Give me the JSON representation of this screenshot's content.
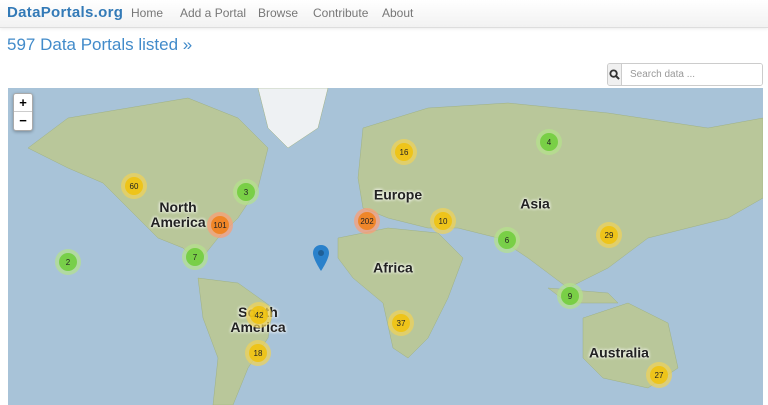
{
  "nav": {
    "brand": "DataPortals.org",
    "items": [
      "Home",
      "Add a Portal",
      "Browse",
      "Contribute",
      "About"
    ]
  },
  "title": "597 Data Portals listed »",
  "search": {
    "placeholder": "Search data ...",
    "icon": "search-icon"
  },
  "map": {
    "zoom_in": "+",
    "zoom_out": "−",
    "labels": {
      "north_america": "North\nAmerica",
      "south_america": "South\nAmerica",
      "europe": "Europe",
      "africa": "Africa",
      "asia": "Asia",
      "australia": "Australia"
    },
    "clusters": [
      {
        "count": "60",
        "level": "y"
      },
      {
        "count": "3",
        "level": "g"
      },
      {
        "count": "101",
        "level": "o"
      },
      {
        "count": "7",
        "level": "g"
      },
      {
        "count": "2",
        "level": "g"
      },
      {
        "count": "42",
        "level": "y"
      },
      {
        "count": "18",
        "level": "y"
      },
      {
        "count": "16",
        "level": "y"
      },
      {
        "count": "202",
        "level": "o"
      },
      {
        "count": "10",
        "level": "y"
      },
      {
        "count": "37",
        "level": "y"
      },
      {
        "count": "4",
        "level": "g"
      },
      {
        "count": "6",
        "level": "g"
      },
      {
        "count": "29",
        "level": "y"
      },
      {
        "count": "9",
        "level": "g"
      },
      {
        "count": "27",
        "level": "y"
      }
    ],
    "colors": {
      "ocean": "#a8c3d8",
      "small": "#6ecc39",
      "medium": "#f0c20c",
      "large": "#f18017",
      "marker": "#2a81cb"
    }
  }
}
